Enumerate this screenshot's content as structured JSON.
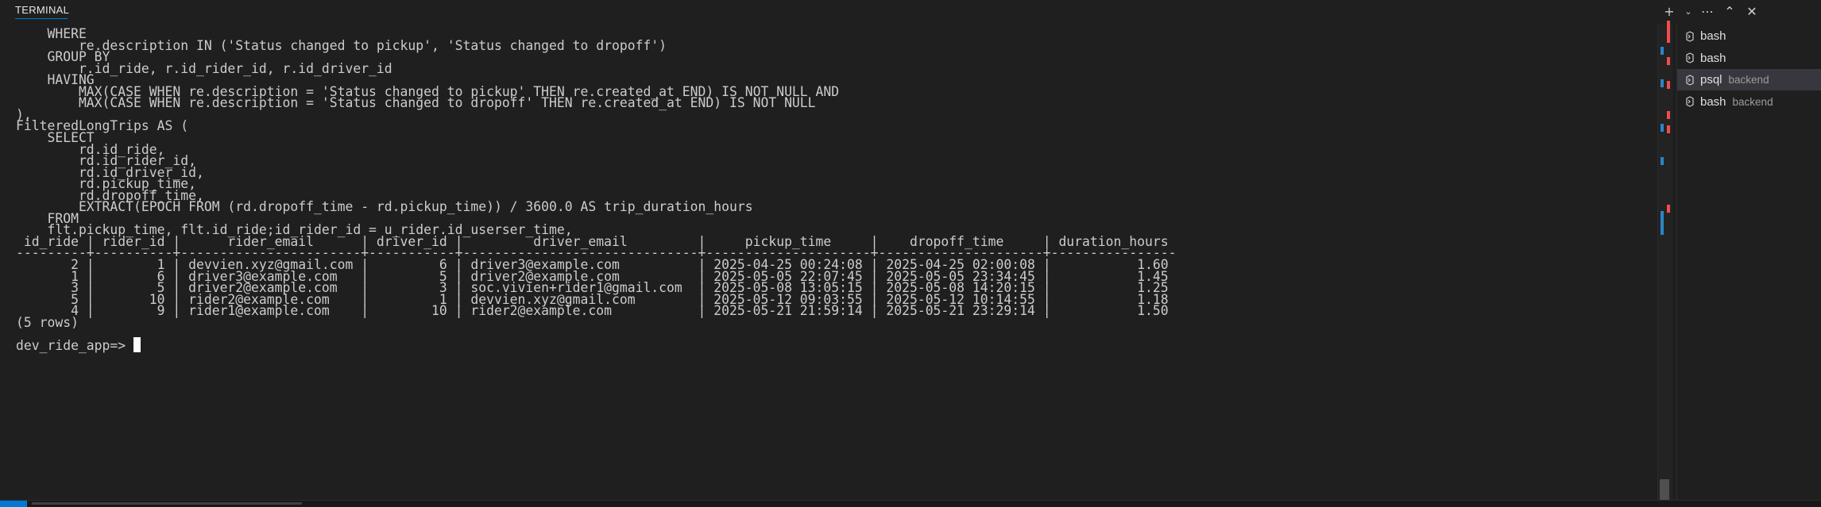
{
  "panel": {
    "title": "TERMINAL"
  },
  "icons": {
    "new_terminal": "plus-icon",
    "dropdown": "chevron-down-icon",
    "more": "ellipsis-icon",
    "maximize": "chevron-up-icon",
    "close": "close-icon",
    "shell": "terminal-shell-icon"
  },
  "terminal": {
    "lines": [
      "    WHERE",
      "        re.description IN ('Status changed to pickup', 'Status changed to dropoff')",
      "    GROUP BY",
      "        r.id_ride, r.id_rider_id, r.id_driver_id",
      "    HAVING",
      "        MAX(CASE WHEN re.description = 'Status changed to pickup' THEN re.created_at END) IS NOT NULL AND",
      "        MAX(CASE WHEN re.description = 'Status changed to dropoff' THEN re.created_at END) IS NOT NULL",
      "),",
      "FilteredLongTrips AS (",
      "    SELECT",
      "        rd.id_ride,",
      "        rd.id_rider_id,",
      "        rd.id_driver_id,",
      "        rd.pickup_time,",
      "        rd.dropoff_time,",
      "        EXTRACT(EPOCH FROM (rd.dropoff_time - rd.pickup_time)) / 3600.0 AS trip_duration_hours",
      "    FROM",
      "    flt.pickup_time, flt.id_ride;id_rider_id = u_rider.id_userser_time,",
      " id_ride | rider_id |      rider_email      | driver_id |         driver_email         |     pickup_time     |    dropoff_time     | duration_hours",
      "---------+----------+-----------------------+-----------+------------------------------+---------------------+---------------------+----------------",
      "       2 |        1 | devvien.xyz@gmail.com |         6 | driver3@example.com          | 2025-04-25 00:24:08 | 2025-04-25 02:00:08 |           1.60",
      "       1 |        6 | driver3@example.com   |         5 | driver2@example.com          | 2025-05-05 22:07:45 | 2025-05-05 23:34:45 |           1.45",
      "       3 |        5 | driver2@example.com   |         3 | soc.vivien+rider1@gmail.com  | 2025-05-08 13:05:15 | 2025-05-08 14:20:15 |           1.25",
      "       5 |       10 | rider2@example.com    |         1 | devvien.xyz@gmail.com        | 2025-05-12 09:03:55 | 2025-05-12 10:14:55 |           1.18",
      "       4 |        9 | rider1@example.com    |        10 | rider2@example.com           | 2025-05-21 21:59:14 | 2025-05-21 23:29:14 |           1.50",
      "(5 rows)",
      ""
    ],
    "prompt": "dev_ride_app=> "
  },
  "sessions": [
    {
      "name": "bash",
      "desc": ""
    },
    {
      "name": "bash",
      "desc": ""
    },
    {
      "name": "psql",
      "desc": "backend"
    },
    {
      "name": "bash",
      "desc": "backend"
    }
  ],
  "colors": {
    "background": "#1f1f1f",
    "text": "#cccccc",
    "accent": "#0078d4",
    "error_mark": "#f14c4c",
    "info_mark": "#2a86c9",
    "active_session": "#37373d"
  }
}
